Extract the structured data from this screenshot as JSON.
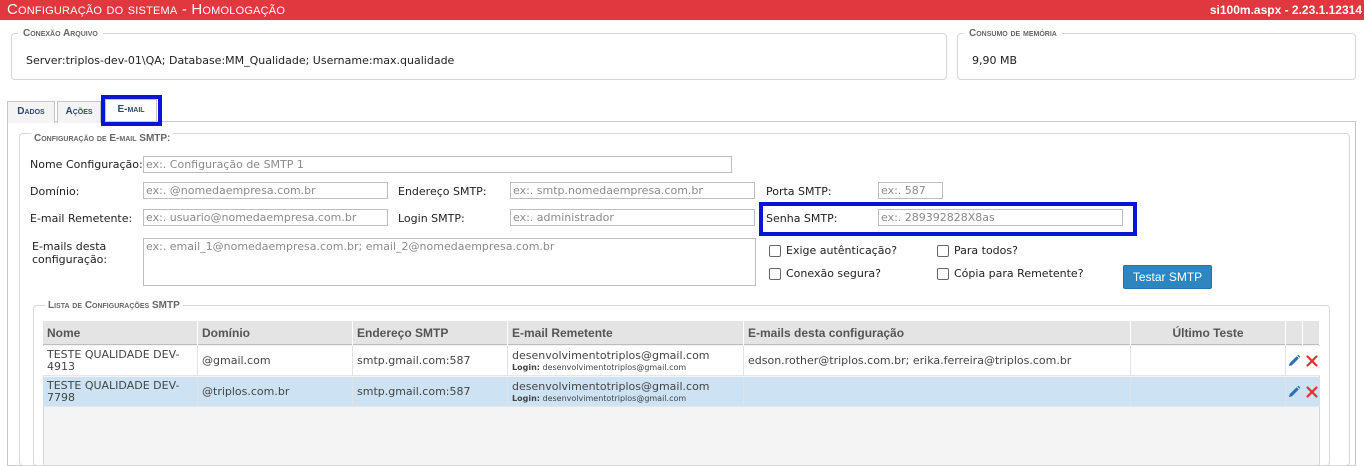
{
  "header": {
    "title": "Configuração do sistema  - Homologação",
    "version": "si100m.aspx - 2.23.1.12314"
  },
  "conexao": {
    "legend": "Conexão Arquivo",
    "value": "Server:triplos-dev-01\\QA; Database:MM_Qualidade; Username:max.qualidade"
  },
  "memoria": {
    "legend": "Consumo de memória",
    "value": "9,90 MB"
  },
  "tabs": [
    {
      "label": "Dados",
      "active": false
    },
    {
      "label": "Ações",
      "active": false
    },
    {
      "label": "E-mail",
      "active": true
    }
  ],
  "smtp_form": {
    "legend": "Configuração de E-mail SMTP:",
    "nome": {
      "label": "Nome Configuração:",
      "placeholder": "ex:. Configuração de SMTP 1"
    },
    "dominio": {
      "label": "Domínio:",
      "placeholder": "ex:. @nomedaempresa.com.br"
    },
    "endereco": {
      "label": "Endereço SMTP:",
      "placeholder": "ex:. smtp.nomedaempresa.com.br"
    },
    "porta": {
      "label": "Porta SMTP:",
      "placeholder": "ex:. 587"
    },
    "remetente": {
      "label": "E-mail Remetente:",
      "placeholder": "ex:. usuario@nomedaempresa.com.br"
    },
    "login": {
      "label": "Login SMTP:",
      "placeholder": "ex:. administrador"
    },
    "senha": {
      "label": "Senha SMTP:",
      "placeholder": "ex:. 289392828X8as"
    },
    "emails": {
      "label_line1": "E-mails desta",
      "label_line2": "configuração:",
      "placeholder": "ex:. email_1@nomedaempresa.com.br; email_2@nomedaempresa.com.br"
    },
    "checkboxes": {
      "auth": "Exige autênticação?",
      "todos": "Para todos?",
      "segura": "Conexão segura?",
      "copia": "Cópia para Remetente?"
    },
    "test_button": "Testar SMTP"
  },
  "list": {
    "legend": "Lista de Configurações SMTP",
    "columns": [
      "Nome",
      "Domínio",
      "Endereço SMTP",
      "E-mail Remetente",
      "E-mails desta configuração",
      "Último Teste"
    ],
    "login_label": "Login:",
    "rows": [
      {
        "nome_l1": "TESTE QUALIDADE DEV-",
        "nome_l2": "4913",
        "dominio": "@gmail.com",
        "endereco": "smtp.gmail.com:587",
        "remetente": "desenvolvimentotriplos@gmail.com",
        "login": "desenvolvimentotriplos@gmail.com",
        "emails": "edson.rother@triplos.com.br; erika.ferreira@triplos.com.br",
        "ultimo": ""
      },
      {
        "nome_l1": "TESTE QUALIDADE DEV-",
        "nome_l2": "7798",
        "dominio": "@triplos.com.br",
        "endereco": "smtp.gmail.com:587",
        "remetente": "desenvolvimentotriplos@gmail.com",
        "login": "desenvolvimentotriplos@gmail.com",
        "emails": "",
        "ultimo": ""
      }
    ]
  },
  "colors": {
    "header_bg": "#e0383e",
    "highlight": "#0a14d6",
    "button_bg": "#2e86c1",
    "selected_row": "#cde3f3",
    "edit_icon": "#2a6fb0",
    "delete_icon": "#e03030"
  }
}
